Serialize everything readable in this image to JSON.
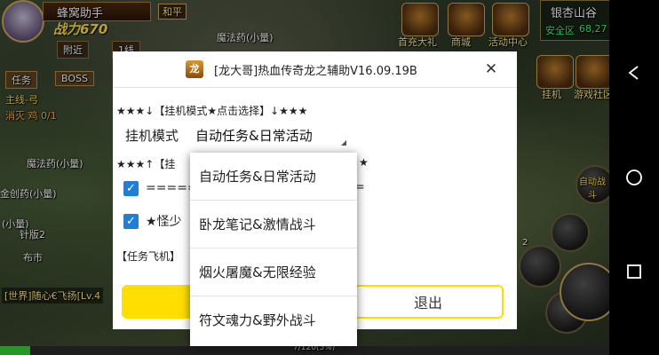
{
  "game": {
    "player_name": "蜂窝助手",
    "mode_tag": "和平",
    "power": "战力670",
    "nearby_btn": "附近",
    "line_btn": "1线",
    "tasks_tab": "任务",
    "boss_tab": "BOSS",
    "main_quest": "主线-弓",
    "quest_progress": "消灭 鸡 0/1",
    "location_name": "银杏山谷",
    "safe_zone": "安全区",
    "coords": "68,27",
    "top_menu": [
      "首充大礼",
      "商城",
      "活动中心"
    ],
    "side_menu": [
      "挂机",
      "游戏社区"
    ],
    "auto_battle": "自动战斗",
    "drop_labels": [
      "魔法药(小量)",
      "魔法药(小量)",
      "金创药(小量)",
      "(小量)",
      "针版2",
      "布市"
    ],
    "chat_line": "[世界]随心€飞扬[Lv.4",
    "exp_bar": "7/120(5%)",
    "skill_slot_number": "2"
  },
  "dialog": {
    "title": "[龙大哥]热血传奇龙之辅助V16.09.19B",
    "section_mode": "★★★↓【挂机模式★点击选择】↓★★★",
    "mode_label": "挂机模式",
    "mode_selected": "自动任务&日常活动",
    "section_settings": "★★★↑【挂",
    "settings_suffix": "★",
    "checkbox1_label": "=====",
    "checkbox1_suffix": "=",
    "checkbox2_label": "★怪少",
    "section_task": "【任务飞机】",
    "exit_button": "退出"
  },
  "dropdown": {
    "options": [
      "自动任务&日常活动",
      "卧龙笔记&激情战斗",
      "烟火屠魔&无限经验",
      "符文魂力&野外战斗"
    ]
  },
  "navbar": [
    "back",
    "home",
    "recent"
  ]
}
